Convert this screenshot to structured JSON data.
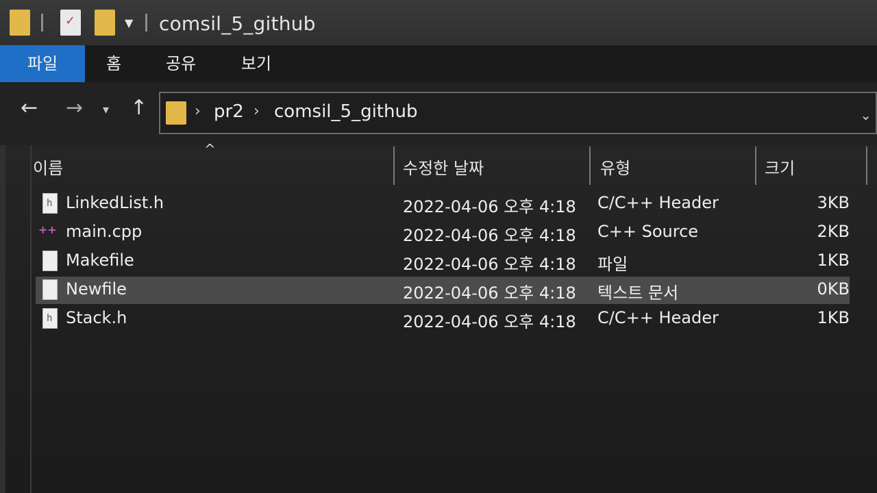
{
  "window": {
    "title": "comsil_5_github"
  },
  "ribbon": {
    "tabs": [
      {
        "label": "파일",
        "active": true
      },
      {
        "label": "홈"
      },
      {
        "label": "공유"
      },
      {
        "label": "보기"
      }
    ]
  },
  "address": {
    "breadcrumb": [
      "pr2",
      "comsil_5_github"
    ]
  },
  "columns": {
    "name": "이름",
    "date": "수정한 날짜",
    "type": "유형",
    "size": "크기"
  },
  "files": [
    {
      "name": "LinkedList.h",
      "date": "2022-04-06 오후 4:18",
      "type": "C/C++ Header",
      "size": "3KB",
      "icon": "header-file-icon"
    },
    {
      "name": "main.cpp",
      "date": "2022-04-06 오후 4:18",
      "type": "C++ Source",
      "size": "2KB",
      "icon": "cpp-file-icon"
    },
    {
      "name": "Makefile",
      "date": "2022-04-06 오후 4:18",
      "type": "파일",
      "size": "1KB",
      "icon": "generic-file-icon"
    },
    {
      "name": "Newfile",
      "date": "2022-04-06 오후 4:18",
      "type": "텍스트 문서",
      "size": "0KB",
      "icon": "text-file-icon",
      "selected": true
    },
    {
      "name": "Stack.h",
      "date": "2022-04-06 오후 4:18",
      "type": "C/C++ Header",
      "size": "1KB",
      "icon": "header-file-icon"
    }
  ],
  "colors": {
    "accent": "#1f6fc6",
    "folder": "#e2b84a",
    "selected_row": "#4b4b4b"
  }
}
